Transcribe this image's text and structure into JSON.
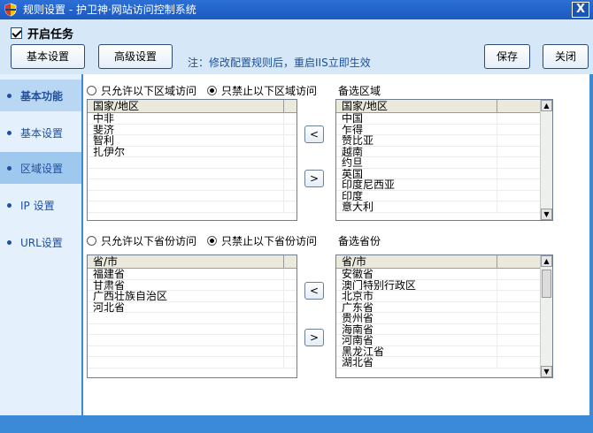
{
  "window": {
    "title": "规则设置 - 护卫神·网站访问控制系统",
    "close_label": "X"
  },
  "topbar": {
    "task_label": "开启任务",
    "task_checked": true,
    "buttons": {
      "basic": "基本设置",
      "advanced": "高级设置",
      "save": "保存",
      "close": "关闭"
    },
    "note": "注：修改配置规则后，重启IIS立即生效"
  },
  "sidebar": {
    "items": [
      {
        "label": "基本功能"
      },
      {
        "label": "基本设置"
      },
      {
        "label": "区域设置"
      },
      {
        "label": "IP 设置"
      },
      {
        "label": "URL设置"
      }
    ]
  },
  "region": {
    "allow_label": "只允许以下区域访问",
    "deny_label": "只禁止以下区域访问",
    "mode": "deny",
    "list_header": "国家/地区",
    "selected": [
      "中非",
      "斐济",
      "智利",
      "扎伊尔"
    ],
    "candidates_title": "备选区域",
    "candidates_header": "国家/地区",
    "candidates": [
      "中国",
      "乍得",
      "赞比亚",
      "越南",
      "约旦",
      "英国",
      "印度尼西亚",
      "印度",
      "意大利"
    ],
    "add_label": "<",
    "remove_label": ">"
  },
  "province": {
    "allow_label": "只允许以下省份访问",
    "deny_label": "只禁止以下省份访问",
    "mode": "deny",
    "list_header": "省/市",
    "selected": [
      "福建省",
      "甘肃省",
      "广西壮族自治区",
      "河北省"
    ],
    "candidates_title": "备选省份",
    "candidates_header": "省/市",
    "candidates": [
      "安徽省",
      "澳门特别行政区",
      "北京市",
      "广东省",
      "贵州省",
      "海南省",
      "河南省",
      "黑龙江省",
      "湖北省"
    ],
    "add_label": "<",
    "remove_label": ">"
  }
}
